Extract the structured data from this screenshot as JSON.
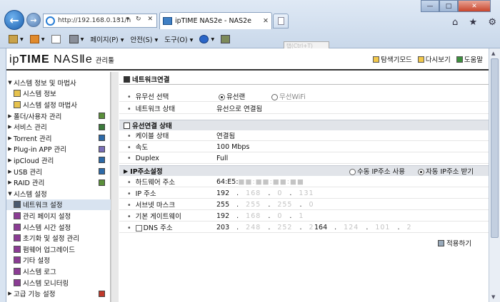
{
  "browser": {
    "address": "http://192.168.0.131/h",
    "address_tools": "⌕ ▾ ↻ ✕",
    "tab_title": "ipTIME NAS2e - NAS2e",
    "tab_close": "✕",
    "back": "←",
    "forward": "→",
    "win_min": "—",
    "win_max": "□",
    "win_close": "✕",
    "right_icons": [
      "⌂",
      "★",
      "⚙"
    ],
    "menu": [
      {
        "label": "▾"
      },
      {
        "label": "▾"
      },
      {
        "label": ""
      },
      {
        "label": "▾"
      },
      {
        "label": "페이지(P) ▾"
      },
      {
        "label": "안전(S) ▾"
      },
      {
        "label": "도구(O) ▾"
      },
      {
        "label": "▾"
      }
    ],
    "tooltip": "탭(Ctrl+T)"
  },
  "header": {
    "logo_ip": "ip",
    "logo_time": "TIME",
    "logo_model": "NASⅡe",
    "logo_sub": "관리툴",
    "links": [
      "탐색기모드",
      "다시보기",
      "도움말"
    ]
  },
  "sidebar": {
    "items": [
      {
        "label": "시스템 정보 및 마법사",
        "type": "group-open"
      },
      {
        "label": "시스템 정보",
        "type": "child"
      },
      {
        "label": "시스템 설정 마법사",
        "type": "child"
      },
      {
        "label": "폴더/사용자 관리",
        "type": "group"
      },
      {
        "label": "서비스 관리",
        "type": "group"
      },
      {
        "label": "Torrent 관리",
        "type": "group"
      },
      {
        "label": "Plug-in APP 관리",
        "type": "group"
      },
      {
        "label": "ipCloud 관리",
        "type": "group"
      },
      {
        "label": "USB 관리",
        "type": "group"
      },
      {
        "label": "RAID 관리",
        "type": "group"
      },
      {
        "label": "시스템 설정",
        "type": "group-open"
      },
      {
        "label": "네트워크 설정",
        "type": "child-selected"
      },
      {
        "label": "관리 페이지 설정",
        "type": "child"
      },
      {
        "label": "시스템 시간 설정",
        "type": "child"
      },
      {
        "label": "초기화 및 설정 관리",
        "type": "child"
      },
      {
        "label": "펌웨어 업그레이드",
        "type": "child"
      },
      {
        "label": "기타 설정",
        "type": "child"
      },
      {
        "label": "시스템 로그",
        "type": "child"
      },
      {
        "label": "시스템 모니터링",
        "type": "child"
      },
      {
        "label": "고급 기능 설정",
        "type": "group"
      }
    ]
  },
  "main": {
    "title": "네트워크연결",
    "conn_select_label": "유무선 선택",
    "wired": "유선랜",
    "wireless": "무선WiFi",
    "net_status_label": "네트워크 상태",
    "net_status_value": "유선으로 연결됨",
    "wired_section": "유선연결 상태",
    "cable_label": "케이블 상태",
    "cable_value": "연결됨",
    "speed_label": "속도",
    "speed_value": "100 Mbps",
    "duplex_label": "Duplex",
    "duplex_value": "Full",
    "ip_section": "IP주소설정",
    "manual_ip": "수동 IP주소 사용",
    "auto_ip": "자동 IP주소 받기",
    "mac_label": "하드웨어 주소",
    "mac_value": "64:E5:",
    "mac_blur": "■■:■■:■■:■■",
    "ip_label": "IP 주소",
    "ip_value": [
      "192",
      "168",
      "0",
      "131"
    ],
    "mask_label": "서브넷 마스크",
    "mask_value": [
      "255",
      "255",
      "255",
      "0"
    ],
    "gw_label": "기본 게이트웨이",
    "gw_value": [
      "192",
      "168",
      "0",
      "1"
    ],
    "dns_label": "DNS 주소",
    "dns1": [
      "203",
      "248",
      "252",
      "2"
    ],
    "dns2": [
      "164",
      "124",
      "101",
      "2"
    ],
    "apply": "적용하기"
  }
}
